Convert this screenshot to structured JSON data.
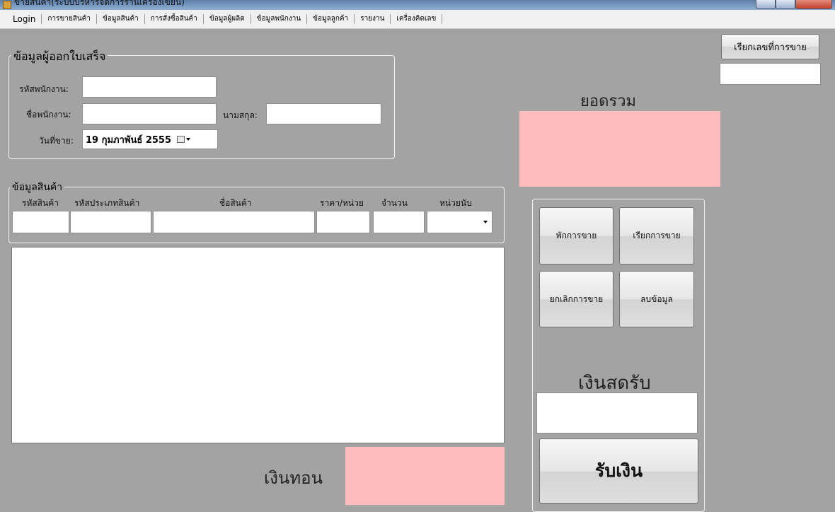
{
  "window": {
    "title": "ขายสินค้า(ระบบบริหารจัดการร้านเครื่องเขียน)"
  },
  "menu": [
    "Login",
    "การขายสินค้า",
    "ข้อมูลสินค้า",
    "การสั่งซื้อสินค้า",
    "ข้อมูลผู้ผลิต",
    "ข้อมูลพนักงาน",
    "ข้อมูลลูกค้า",
    "รายงาน",
    "เครื่องคิดเลข"
  ],
  "issuer": {
    "legend": "ข้อมูลผู้ออกใบเสร็จ",
    "employee_id_label": "รหัสพนักงาน:",
    "employee_id_value": "",
    "employee_name_label": "ชื่อพนักงาน:",
    "employee_name_value": "",
    "surname_label": "นามสกุล:",
    "surname_value": "",
    "sale_date_label": "วันที่ขาย:",
    "sale_date_value": "19 กุมภาพันธ์  2555"
  },
  "product": {
    "legend": "ข้อมูลสินค้า",
    "columns": [
      "รหัสสินค้า",
      "รหัสประเภทสินค้า",
      "ชื่อสินค้า",
      "ราคา/หน่วย",
      "จำนวน",
      "หน่วยนับ"
    ]
  },
  "sale_id_button": "เรียกเลขที่การขาย",
  "sale_id_value": "",
  "total_label": "ยอดรวม",
  "total_value": "",
  "buttons": {
    "hold": "พักการขาย",
    "recall": "เรียกการขาย",
    "cancel": "ยกเลิกการขาย",
    "delete": "ลบข้อมูล"
  },
  "cash_label": "เงินสดรับ",
  "cash_value": "",
  "receive_button": "รับเงิน",
  "change_label": "เงินทอน",
  "change_value": ""
}
